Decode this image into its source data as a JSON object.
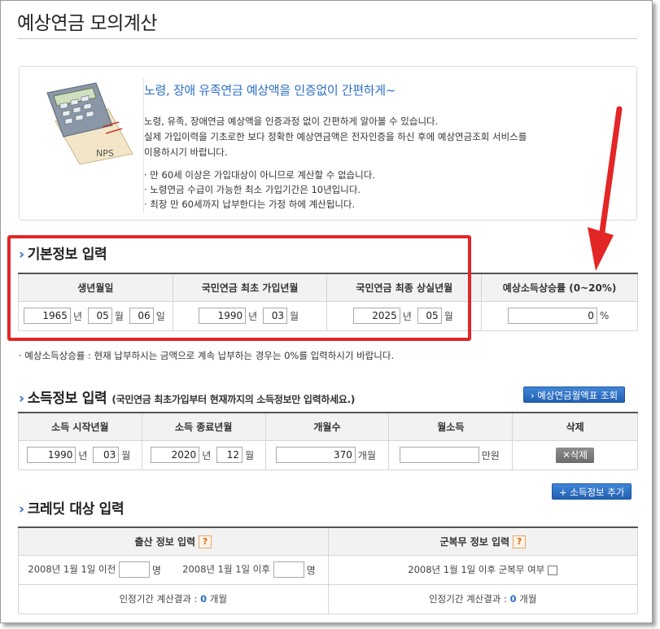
{
  "page": {
    "title": "예상연금 모의계산"
  },
  "intro": {
    "heading": "노령, 장애 유족연금 예상액을 인증없이 간편하게~",
    "p1_line1": "노령, 유족, 장애연금 예상액을 인증과정 없이 간편하게 알아볼 수 있습니다.",
    "p1_line2": "실제 가입이력을 기초로한 보다 정확한 예상연금액은 전자인증을 하신 후에 예상연금조회 서비스를",
    "p1_line3": "이용하시기 바랍니다.",
    "bullet1": "· 만 60세 이상은 가입대상이 아니므로 계산할 수 없습니다.",
    "bullet2": "· 노령연금 수급이 가능한 최소 가입기간은 10년입니다.",
    "bullet3": "· 최장 만 60세까지 납부한다는 가정 하에 계산됩니다.",
    "image_label": "NPS"
  },
  "basic": {
    "title": "기본정보 입력",
    "headers": [
      "생년월일",
      "국민연금 최초 가입년월",
      "국민연금 최종 상실년월",
      "예상소득상승률 (0~20%)"
    ],
    "birth_year": "1965",
    "birth_month": "05",
    "birth_day": "06",
    "first_year": "1990",
    "first_month": "03",
    "last_year": "2025",
    "last_month": "05",
    "rate": "0",
    "unit_year": "년",
    "unit_month": "월",
    "unit_day": "일",
    "unit_percent": "%",
    "note": "· 예상소득상승률 : 현재 납부하시는 금액으로 계속 납부하는 경우는 0%를 입력하시기 바랍니다."
  },
  "income": {
    "title": "소득정보 입력",
    "subtitle": "(국민연금 최초가입부터 현재까지의 소득정보만 입력하세요.)",
    "lookup_button": "› 예상연금월액표 조회",
    "headers": [
      "소득 시작년월",
      "소득 종료년월",
      "개월수",
      "월소득",
      "삭제"
    ],
    "start_year": "1990",
    "start_month": "03",
    "end_year": "2020",
    "end_month": "12",
    "months": "370",
    "months_unit": "개월",
    "monthly_income": "",
    "income_unit": "만원",
    "delete_button": "✕삭제",
    "add_button": "+ 소득정보 추가"
  },
  "credit": {
    "title": "크레딧 대상 입력",
    "birth_header": "출산 정보 입력",
    "military_header": "군복무 정보 입력",
    "help_icon": "?",
    "before_label": "2008년 1월 1일 이전",
    "after_label": "2008년 1월 1일 이후",
    "person_unit": "명",
    "military_label": "2008년 1월 1일 이후 군복무 여부",
    "result_label": "인정기간 계산결과 :",
    "birth_result": "0",
    "military_result": "0",
    "result_unit": "개월"
  },
  "colors": {
    "accent_blue": "#2c6fc4",
    "highlight_red": "#e32626"
  }
}
